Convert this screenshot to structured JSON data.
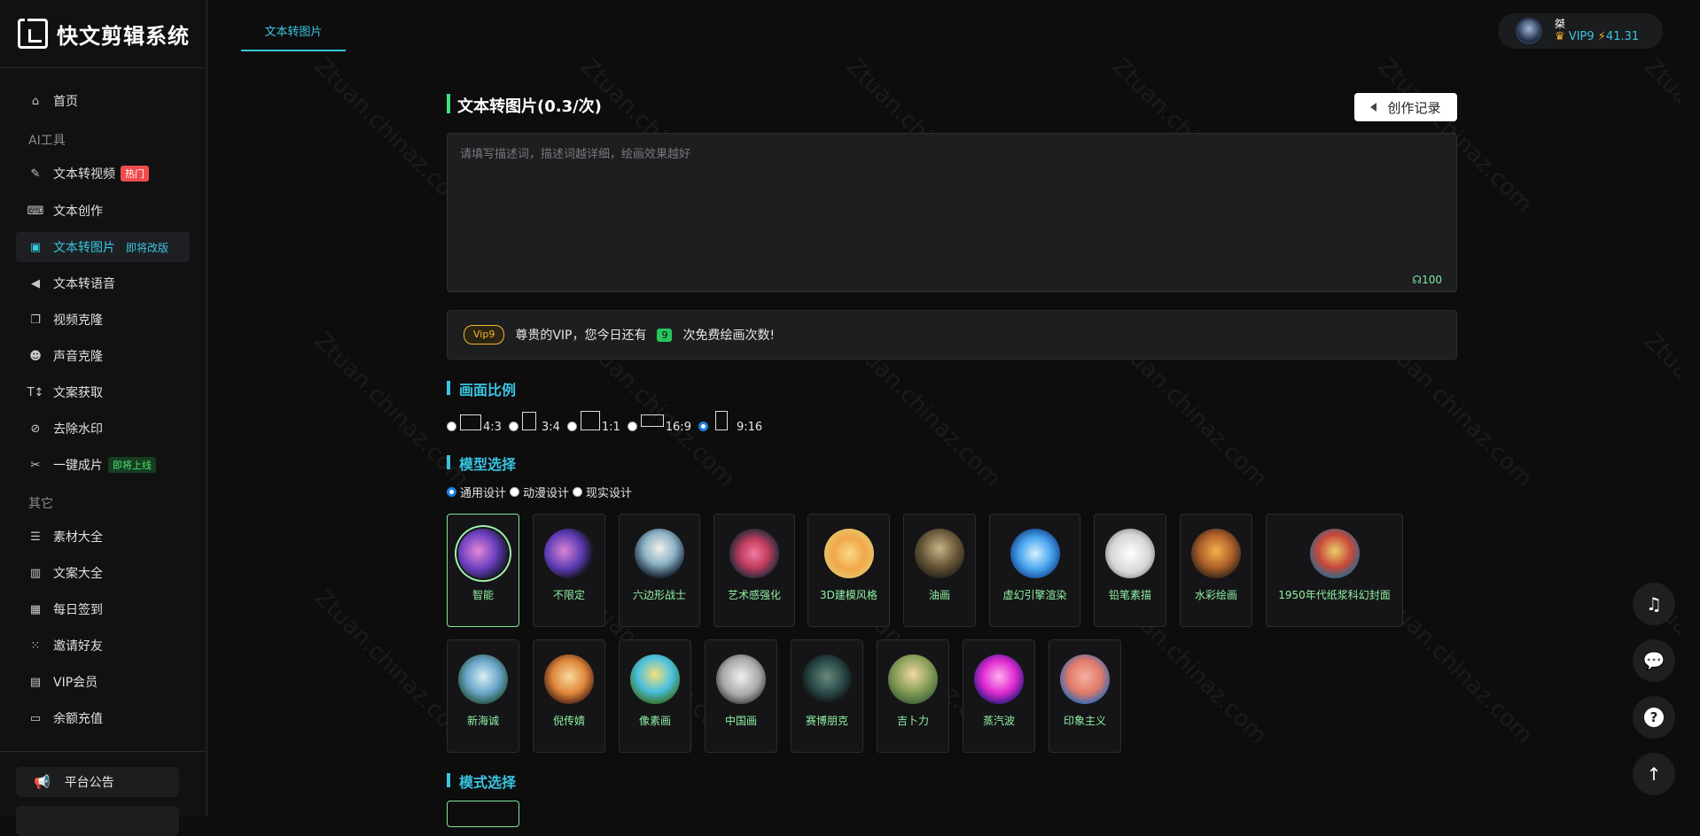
{
  "app": {
    "title": "快文剪辑系统"
  },
  "sidebar": {
    "items": [
      {
        "label": "首页",
        "icon": "home-icon"
      },
      {
        "label": "文本转视频",
        "icon": "magic-wand-icon",
        "badge": "热门"
      },
      {
        "label": "文本创作",
        "icon": "keyboard-icon"
      },
      {
        "label": "文本转图片",
        "icon": "image-icon",
        "badge": "即将改版"
      },
      {
        "label": "文本转语音",
        "icon": "speaker-icon"
      },
      {
        "label": "视频克隆",
        "icon": "copy-icon"
      },
      {
        "label": "声音克隆",
        "icon": "users-icon"
      },
      {
        "label": "文案获取",
        "icon": "text-height-icon"
      },
      {
        "label": "去除水印",
        "icon": "droplet-slash-icon"
      },
      {
        "label": "一键成片",
        "icon": "scissors-icon",
        "badge": "即将上线"
      },
      {
        "label": "素材大全",
        "icon": "list-icon"
      },
      {
        "label": "文案大全",
        "icon": "book-icon"
      },
      {
        "label": "每日签到",
        "icon": "calendar-icon"
      },
      {
        "label": "邀请好友",
        "icon": "invite-icon"
      },
      {
        "label": "VIP会员",
        "icon": "id-card-icon"
      },
      {
        "label": "余额充值",
        "icon": "wallet-icon"
      }
    ],
    "sections": {
      "ai_tools": "AI工具",
      "other": "其它"
    },
    "notice": "平台公告"
  },
  "header": {
    "tab": "文本转图片",
    "user": {
      "name": "桀",
      "vip": "VIP9",
      "balance": "41.31"
    }
  },
  "main": {
    "title": "文本转图片(0.3/次)",
    "history_button": "创作记录",
    "prompt": {
      "placeholder": "请填写描述词，描述词越详细，绘画效果越好",
      "counter": "100"
    },
    "vip_notice": {
      "tag": "Vip9",
      "before": "尊贵的VIP，您今日还有",
      "count": "9",
      "after": "次免费绘画次数!"
    },
    "ratio_title": "画面比例",
    "ratios": [
      "4:3",
      "3:4",
      "1:1",
      "16:9",
      "9:16"
    ],
    "ratio_selected": "9:16",
    "model_title": "模型选择",
    "models": [
      "通用设计",
      "动漫设计",
      "现实设计"
    ],
    "model_selected": "通用设计",
    "styles_row1": [
      "智能",
      "不限定",
      "六边形战士",
      "艺术感强化",
      "3D建模风格",
      "油画",
      "虚幻引擎渲染",
      "铅笔素描",
      "水彩绘画",
      "1950年代纸浆科幻封面"
    ],
    "styles_row2": [
      "新海诚",
      "倪传婧",
      "像素画",
      "中国画",
      "赛博朋克",
      "吉卜力",
      "蒸汽波",
      "印象主义"
    ],
    "style_selected": "智能",
    "mode_title": "模式选择"
  },
  "watermark": "Ztuan.chinaz.com",
  "colors": {
    "accent": "#39c5e0",
    "green": "#3fe27a",
    "hot": "#f04b4b"
  }
}
